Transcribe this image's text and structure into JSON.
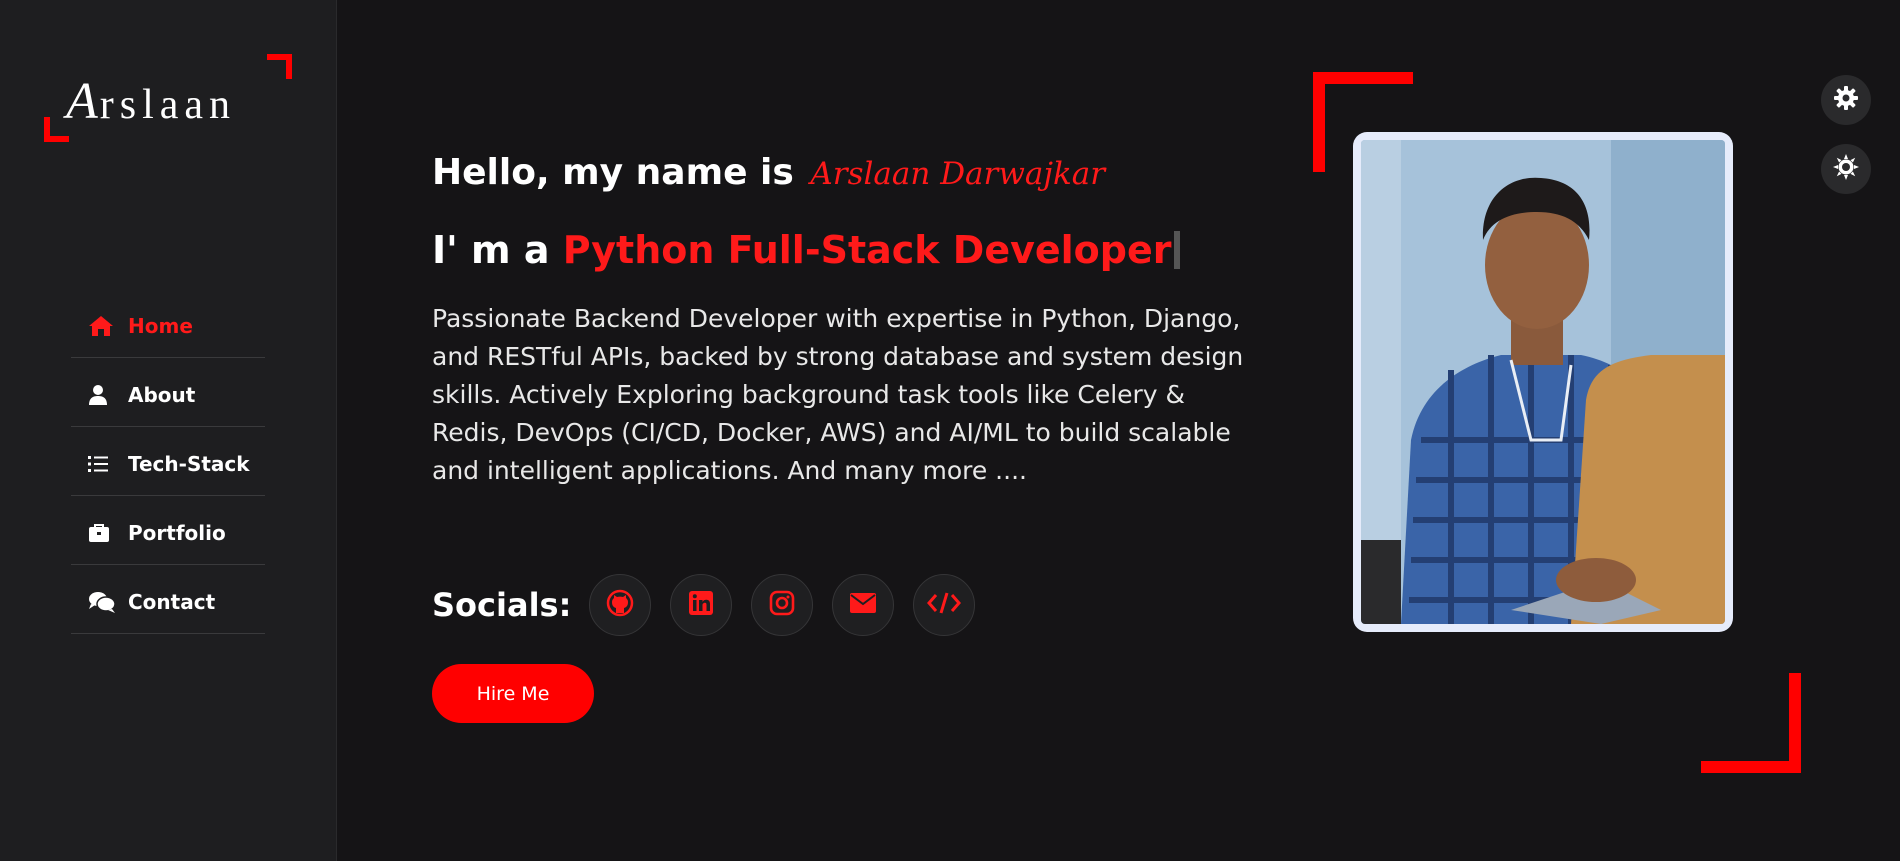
{
  "logo": {
    "first": "A",
    "rest": "rslaan"
  },
  "nav": {
    "items": [
      {
        "label": "Home",
        "icon": "home-icon",
        "active": true
      },
      {
        "label": "About",
        "icon": "user-icon",
        "active": false
      },
      {
        "label": "Tech-Stack",
        "icon": "list-icon",
        "active": false
      },
      {
        "label": "Portfolio",
        "icon": "briefcase-icon",
        "active": false
      },
      {
        "label": "Contact",
        "icon": "comments-icon",
        "active": false
      }
    ]
  },
  "hero": {
    "greeting": "Hello, my name is",
    "name": "Arslaan Darwajkar",
    "role_prefix": "I' m a",
    "role": "Python Full-Stack Developer",
    "bio": "Passionate Backend Developer with expertise in Python, Django, and RESTful APIs, backed by strong database and system design skills. Actively Exploring background task tools like Celery & Redis, DevOps (CI/CD, Docker, AWS) and AI/ML to build scalable and intelligent applications. And many more ....",
    "socials_label": "Socials:",
    "socials": [
      {
        "icon": "github-icon"
      },
      {
        "icon": "linkedin-icon"
      },
      {
        "icon": "instagram-icon"
      },
      {
        "icon": "envelope-icon"
      },
      {
        "icon": "code-icon"
      }
    ],
    "hire_label": "Hire Me"
  },
  "settings": [
    {
      "icon": "gear-icon"
    },
    {
      "icon": "sun-icon"
    }
  ],
  "colors": {
    "accent": "#ff0000",
    "background": "#151416",
    "sidebar": "#1e1e20"
  }
}
